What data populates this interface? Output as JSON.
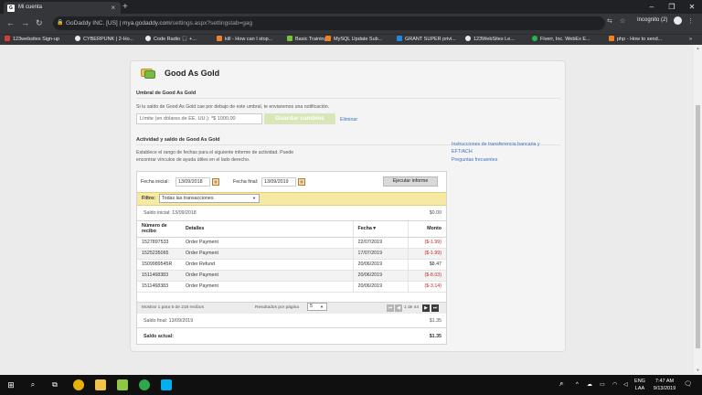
{
  "browser": {
    "tab_title": "Mi cuenta",
    "tab_favicon": "G",
    "tab_close": "×",
    "new_tab": "+",
    "url_site": "GoDaddy INC. [US]",
    "url_sep": " | ",
    "url_host": "mya.godaddy.com",
    "url_path": "/settings.aspx?settingstab=gag",
    "incognito_label": "Incognito (2)",
    "bookmarks": [
      {
        "label": "123websites Sign-up",
        "color": "#d73a3a"
      },
      {
        "label": "CYBERPUNK | 2-Ho...",
        "color": "#e8eaed"
      },
      {
        "label": "Code Radio 🎧 +...",
        "color": "#e8eaed"
      },
      {
        "label": "kill - How can I stop...",
        "color": "#f48024"
      },
      {
        "label": "Basic Training",
        "color": "#7cbf3a"
      },
      {
        "label": "MySQL Update Sub...",
        "color": "#f48024"
      },
      {
        "label": "GRANT SUPER privi...",
        "color": "#1e88e5"
      },
      {
        "label": "123WebSites Le...",
        "color": "#e8eaed"
      },
      {
        "label": "Fiverr, Inc. WebEx E...",
        "color": "#1db954"
      },
      {
        "label": "php - How to send...",
        "color": "#f48024"
      }
    ],
    "bookmarks_more": "»"
  },
  "page": {
    "title": "Good As Gold",
    "threshold": {
      "heading": "Umbral de Good As Gold",
      "description": "Si tu saldo de Good As Gold cae por debajo de este umbral, te enviaremos una notificación.",
      "input_value": "Límite (en dólares de EE. UU.): *$ 1000.00",
      "save_label": "Guardar cambios",
      "delete_label": "Eliminar"
    },
    "activity": {
      "heading": "Actividad y saldo de Good As Gold",
      "description_line1": "Establece el rango de fechas para el siguiente informe de actividad. Puede",
      "description_line2": "encontrar vínculos de ayuda útiles en el lado derecho.",
      "start_label": "Fecha inicial:",
      "start_value": "13/09/2018",
      "end_label": "Fecha final:",
      "end_value": "13/09/2019",
      "run_label": "Ejecutar informe",
      "filter_label": "Filtro:",
      "filter_value": "Todas las transacciones",
      "opening_label": "Saldo inicial: 13/09/2018",
      "opening_amount": "$0.00",
      "columns": {
        "receipt_line1": "Número de",
        "receipt_line2": "recibo",
        "details": "Detalles",
        "date": "Fecha ▾",
        "amount": "Monto"
      },
      "rows": [
        {
          "receipt": "1527897533",
          "details": "Order Payment",
          "date": "22/07/2019",
          "amount": "($-1.99)"
        },
        {
          "receipt": "1525235065",
          "details": "Order Payment",
          "date": "17/07/2019",
          "amount": "($-1.99)"
        },
        {
          "receipt": "1509989545R",
          "details": "Order Refund",
          "date": "20/06/2019",
          "amount": "$8.47"
        },
        {
          "receipt": "1511468383",
          "details": "Order Payment",
          "date": "20/06/2019",
          "amount": "($-8.03)"
        },
        {
          "receipt": "1511468383",
          "details": "Order Payment",
          "date": "20/06/2019",
          "amount": "($-3.14)"
        }
      ],
      "showing_text": "Mostrar 1 para 5 de 218 recibos",
      "per_page_label": "Resultados por página",
      "per_page_value": "5",
      "page_info": "1 de 44",
      "closing_label": "Saldo final: 13/09/2019",
      "closing_amount": "$1.35",
      "current_label": "Saldo actual:",
      "current_amount": "$1.35"
    },
    "help_links": {
      "transfer": "Instrucciones de transferencia bancaria y EFT/ACH",
      "faq": "Preguntas frecuentes"
    }
  },
  "taskbar": {
    "lang": "ENG",
    "layout": "LAA",
    "time": "7:47 AM",
    "date": "9/13/2019"
  }
}
